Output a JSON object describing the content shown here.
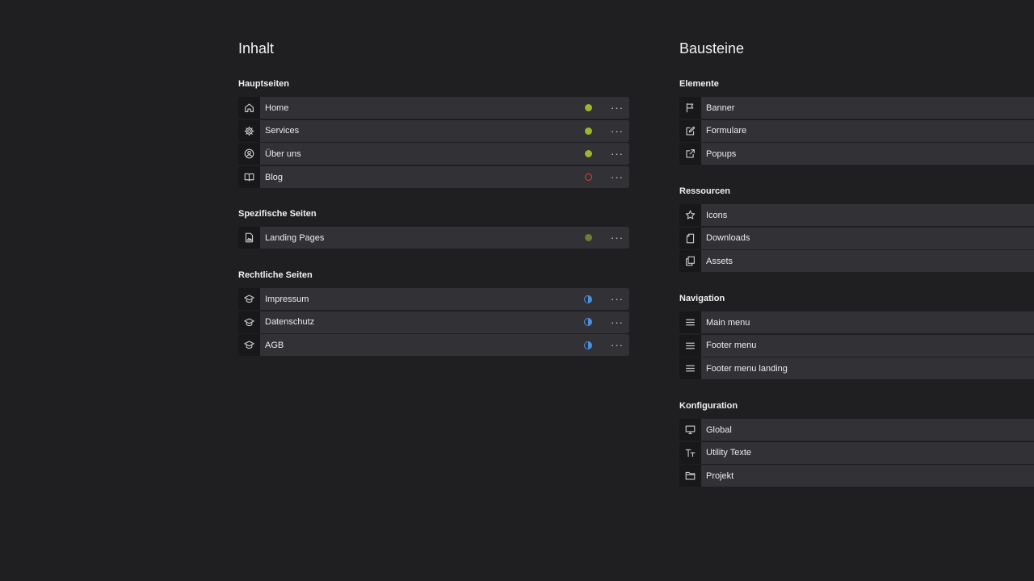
{
  "left": {
    "title": "Inhalt",
    "sections": [
      {
        "title": "Hauptseiten",
        "items": [
          {
            "label": "Home",
            "icon": "home-icon",
            "status": "green"
          },
          {
            "label": "Services",
            "icon": "gear-icon",
            "status": "green"
          },
          {
            "label": "Über uns",
            "icon": "user-circle-icon",
            "status": "green"
          },
          {
            "label": "Blog",
            "icon": "book-icon",
            "status": "red"
          }
        ]
      },
      {
        "title": "Spezifische Seiten",
        "items": [
          {
            "label": "Landing Pages",
            "icon": "image-file-icon",
            "status": "green-dim"
          }
        ]
      },
      {
        "title": "Rechtliche Seiten",
        "items": [
          {
            "label": "Impressum",
            "icon": "graduation-cap-icon",
            "status": "half"
          },
          {
            "label": "Datenschutz",
            "icon": "graduation-cap-icon",
            "status": "half"
          },
          {
            "label": "AGB",
            "icon": "graduation-cap-icon",
            "status": "half"
          }
        ]
      }
    ]
  },
  "right": {
    "title": "Bausteine",
    "sections": [
      {
        "title": "Elemente",
        "items": [
          {
            "label": "Banner",
            "icon": "flag-icon"
          },
          {
            "label": "Formulare",
            "icon": "edit-form-icon"
          },
          {
            "label": "Popups",
            "icon": "external-link-icon"
          }
        ]
      },
      {
        "title": "Ressourcen",
        "items": [
          {
            "label": "Icons",
            "icon": "star-icon"
          },
          {
            "label": "Downloads",
            "icon": "document-icon"
          },
          {
            "label": "Assets",
            "icon": "copy-icon"
          }
        ]
      },
      {
        "title": "Navigation",
        "items": [
          {
            "label": "Main menu",
            "icon": "menu-icon"
          },
          {
            "label": "Footer menu",
            "icon": "menu-icon"
          },
          {
            "label": "Footer menu landing",
            "icon": "menu-icon"
          }
        ]
      },
      {
        "title": "Konfiguration",
        "items": [
          {
            "label": "Global",
            "icon": "monitor-icon"
          },
          {
            "label": "Utility Texte",
            "icon": "text-size-icon"
          },
          {
            "label": "Projekt",
            "icon": "folder-icon"
          }
        ]
      }
    ]
  },
  "more_glyph": "···",
  "colors": {
    "background": "#1f1e21",
    "row": "#323135",
    "status_green": "#9ab52e",
    "status_red": "#e04040",
    "status_blue": "#4a8fe0"
  }
}
